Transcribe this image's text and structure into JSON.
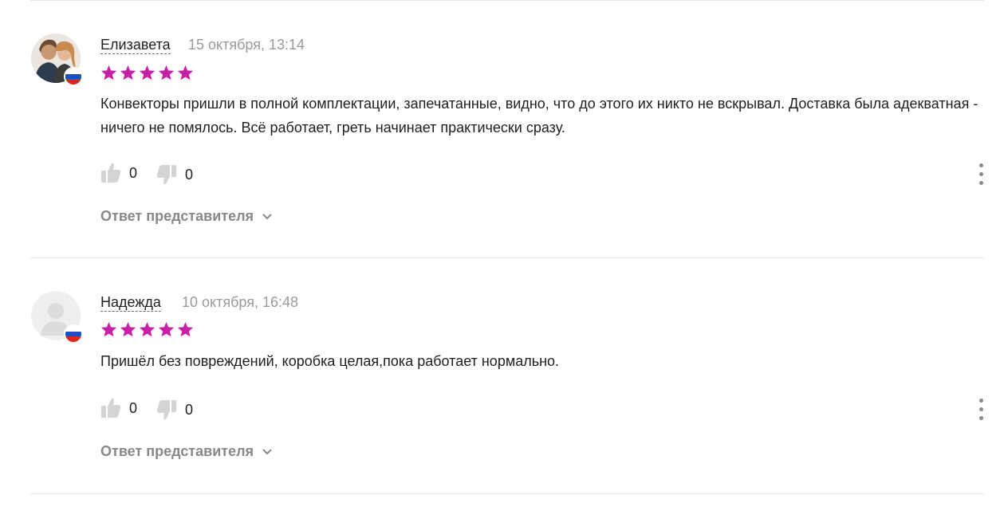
{
  "reviews": [
    {
      "author": "Елизавета",
      "date": "15 октября, 13:14",
      "rating": 5,
      "text": "Конвекторы пришли в полной комплектации, запечатанные, видно, что до этого их никто не вскрывал. Доставка была адекватная - ничего не помялось. Всё работает, греть начинает практически сразу.",
      "likes": "0",
      "dislikes": "0",
      "reply_label": "Ответ представителя",
      "avatar": "user-photo",
      "country_flag": "russia-flag-icon"
    },
    {
      "author": "Надежда",
      "date": "10 октября, 16:48",
      "rating": 5,
      "text": "Пришёл без повреждений, коробка целая,пока работает нормально.",
      "likes": "0",
      "dislikes": "0",
      "reply_label": "Ответ представителя",
      "avatar": "default-user-icon",
      "country_flag": "russia-flag-icon"
    }
  ],
  "colors": {
    "star": "#c81fa8",
    "muted": "#9a9a9a",
    "icon": "#d4d4d4"
  }
}
